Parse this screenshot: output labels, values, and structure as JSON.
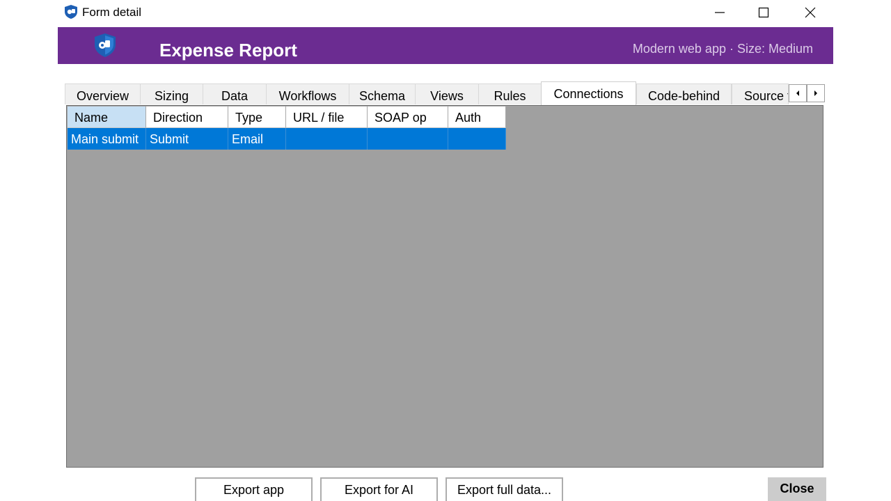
{
  "window": {
    "title": "Form detail",
    "app_icon": "shield-app-icon"
  },
  "banner": {
    "title": "Expense Report",
    "meta": "Modern web app · Size: Medium",
    "bg_color": "#6b2c91"
  },
  "tabs": [
    {
      "label": "Overview"
    },
    {
      "label": "Sizing"
    },
    {
      "label": "Data"
    },
    {
      "label": "Workflows"
    },
    {
      "label": "Schema"
    },
    {
      "label": "Views"
    },
    {
      "label": "Rules"
    },
    {
      "label": "Connections"
    },
    {
      "label": "Code-behind"
    },
    {
      "label": "Source f"
    }
  ],
  "active_tab": "Connections",
  "table": {
    "columns": [
      "Name",
      "Direction",
      "Type",
      "URL / file",
      "SOAP op",
      "Auth"
    ],
    "rows": [
      [
        "Main submit",
        "Submit",
        "Email",
        "",
        "",
        ""
      ]
    ],
    "selected_row": 0,
    "selection_color": "#0078d7"
  },
  "buttons": {
    "export_app": "Export app",
    "export_ai": "Export for AI",
    "export_full": "Export full data...",
    "close": "Close"
  }
}
